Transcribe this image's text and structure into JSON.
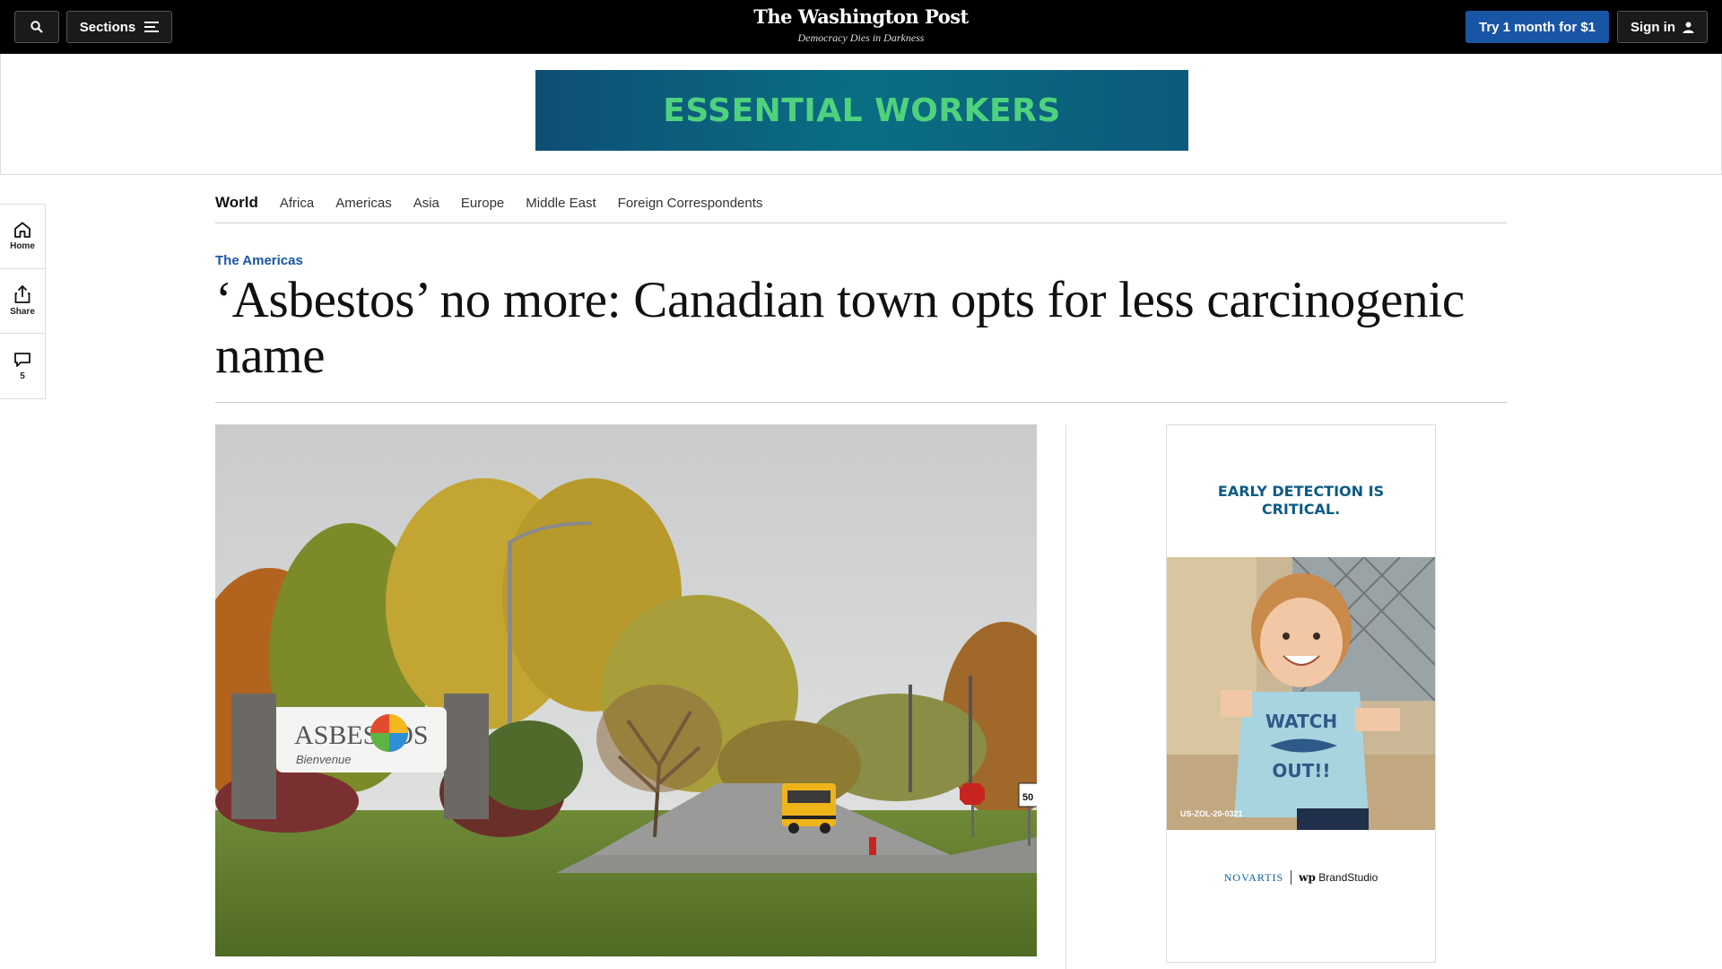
{
  "header": {
    "sections_label": "Sections",
    "logo_text": "The Washington Post",
    "tagline": "Democracy Dies in Darkness",
    "subscribe_label": "Try 1 month for $1",
    "signin_label": "Sign in"
  },
  "top_ad": {
    "text": "ESSENTIAL WORKERS"
  },
  "rail": {
    "home_label": "Home",
    "share_label": "Share",
    "comments_count": "5"
  },
  "section_nav": {
    "primary": "World",
    "items": [
      "Africa",
      "Americas",
      "Asia",
      "Europe",
      "Middle East",
      "Foreign Correspondents"
    ]
  },
  "article": {
    "kicker": "The Americas",
    "headline": "‘Asbestos’ no more: Canadian town opts for less carcinogenic name"
  },
  "photo": {
    "sign_title": "ASBESTOS",
    "sign_subtitle": "Bienvenue",
    "road_sign_speed": "50"
  },
  "side_ad": {
    "headline_line1": "EARLY DETECTION IS",
    "headline_line2": "CRITICAL.",
    "shirt_line1": "WATCH",
    "shirt_line2": "OUT!!",
    "code": "US-ZOL-20-0321",
    "sponsor": "NOVARTIS",
    "brand_logo": "wp",
    "brand_label": "BrandStudio"
  },
  "colors": {
    "topbar": "#000000",
    "accent_blue": "#1955a5",
    "ad_text_green": "#4fd27c",
    "ad_bg_teal": "#0a6e83"
  },
  "icons": [
    "search-icon",
    "hamburger-icon",
    "user-icon",
    "home-icon",
    "share-icon",
    "comment-icon"
  ]
}
